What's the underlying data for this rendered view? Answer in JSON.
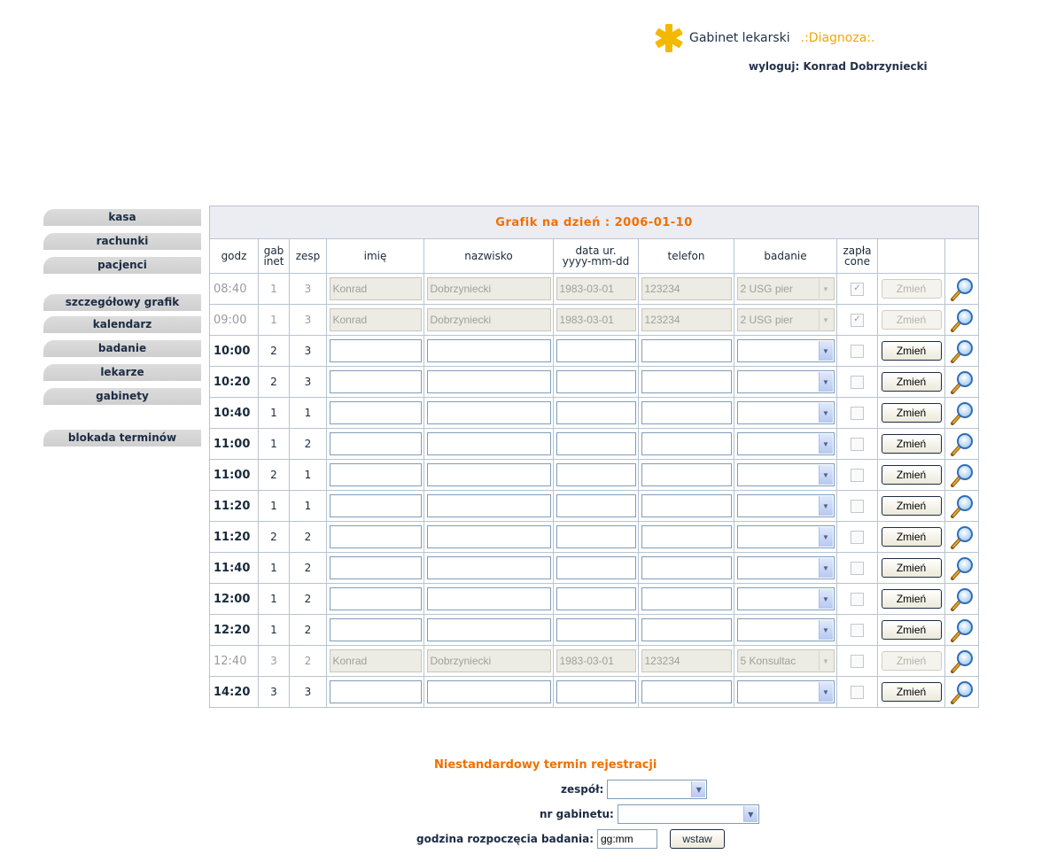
{
  "header": {
    "brand_name": "Gabinet lekarski",
    "brand_sub": ".:Diagnoza:.",
    "logout": "wyloguj: Konrad Dobrzyniecki",
    "logo_icon": "star-of-life-icon",
    "colors": {
      "logo": "#f5b800",
      "accent": "#f07000"
    }
  },
  "sidebar": {
    "group1": [
      {
        "label": "kasa"
      },
      {
        "label": "rachunki"
      },
      {
        "label": "pacjenci"
      }
    ],
    "group2": [
      {
        "label": "szczegółowy grafik"
      },
      {
        "label": "kalendarz"
      },
      {
        "label": "badanie"
      },
      {
        "label": "lekarze"
      },
      {
        "label": "gabinety"
      }
    ],
    "group3": [
      {
        "label": "blokada terminów"
      }
    ]
  },
  "schedule": {
    "title": "Grafik na dzień : 2006-01-10",
    "columns": {
      "godz": "godz",
      "gab_1": "gab",
      "gab_2": "inet",
      "zesp": "zesp",
      "imie": "imię",
      "nazwisko": "nazwisko",
      "data_1": "data ur.",
      "data_2": "yyyy-mm-dd",
      "telefon": "telefon",
      "badanie": "badanie",
      "zapl_1": "zapła",
      "zapl_2": "cone"
    },
    "button_label": "Zmień",
    "rows": [
      {
        "godz": "08:40",
        "gab": "1",
        "zesp": "3",
        "imie": "Konrad",
        "nazwisko": "Dobrzyniecki",
        "data": "1983-03-01",
        "telefon": "123234",
        "badanie": "2 USG pier",
        "paid": true,
        "booked": true
      },
      {
        "godz": "09:00",
        "gab": "1",
        "zesp": "3",
        "imie": "Konrad",
        "nazwisko": "Dobrzyniecki",
        "data": "1983-03-01",
        "telefon": "123234",
        "badanie": "2 USG pier",
        "paid": true,
        "booked": true
      },
      {
        "godz": "10:00",
        "gab": "2",
        "zesp": "3",
        "imie": "",
        "nazwisko": "",
        "data": "",
        "telefon": "",
        "badanie": "",
        "paid": false,
        "booked": false
      },
      {
        "godz": "10:20",
        "gab": "2",
        "zesp": "3",
        "imie": "",
        "nazwisko": "",
        "data": "",
        "telefon": "",
        "badanie": "",
        "paid": false,
        "booked": false
      },
      {
        "godz": "10:40",
        "gab": "1",
        "zesp": "1",
        "imie": "",
        "nazwisko": "",
        "data": "",
        "telefon": "",
        "badanie": "",
        "paid": false,
        "booked": false
      },
      {
        "godz": "11:00",
        "gab": "1",
        "zesp": "2",
        "imie": "",
        "nazwisko": "",
        "data": "",
        "telefon": "",
        "badanie": "",
        "paid": false,
        "booked": false
      },
      {
        "godz": "11:00",
        "gab": "2",
        "zesp": "1",
        "imie": "",
        "nazwisko": "",
        "data": "",
        "telefon": "",
        "badanie": "",
        "paid": false,
        "booked": false
      },
      {
        "godz": "11:20",
        "gab": "1",
        "zesp": "1",
        "imie": "",
        "nazwisko": "",
        "data": "",
        "telefon": "",
        "badanie": "",
        "paid": false,
        "booked": false
      },
      {
        "godz": "11:20",
        "gab": "2",
        "zesp": "2",
        "imie": "",
        "nazwisko": "",
        "data": "",
        "telefon": "",
        "badanie": "",
        "paid": false,
        "booked": false
      },
      {
        "godz": "11:40",
        "gab": "1",
        "zesp": "2",
        "imie": "",
        "nazwisko": "",
        "data": "",
        "telefon": "",
        "badanie": "",
        "paid": false,
        "booked": false
      },
      {
        "godz": "12:00",
        "gab": "1",
        "zesp": "2",
        "imie": "",
        "nazwisko": "",
        "data": "",
        "telefon": "",
        "badanie": "",
        "paid": false,
        "booked": false
      },
      {
        "godz": "12:20",
        "gab": "1",
        "zesp": "2",
        "imie": "",
        "nazwisko": "",
        "data": "",
        "telefon": "",
        "badanie": "",
        "paid": false,
        "booked": false
      },
      {
        "godz": "12:40",
        "gab": "3",
        "zesp": "2",
        "imie": "Konrad",
        "nazwisko": "Dobrzyniecki",
        "data": "1983-03-01",
        "telefon": "123234",
        "badanie": "5 Konsultac",
        "paid": false,
        "booked": true
      },
      {
        "godz": "14:20",
        "gab": "3",
        "zesp": "3",
        "imie": "",
        "nazwisko": "",
        "data": "",
        "telefon": "",
        "badanie": "",
        "paid": false,
        "booked": false
      }
    ]
  },
  "custom": {
    "title": "Niestandardowy termin rejestracji",
    "zespol_label": "zespół:",
    "gabinet_label": "nr gabinetu:",
    "godzina_label": "godzina rozpoczęcia badania:",
    "godzina_value": "gg:mm",
    "submit_label": "wstaw"
  }
}
